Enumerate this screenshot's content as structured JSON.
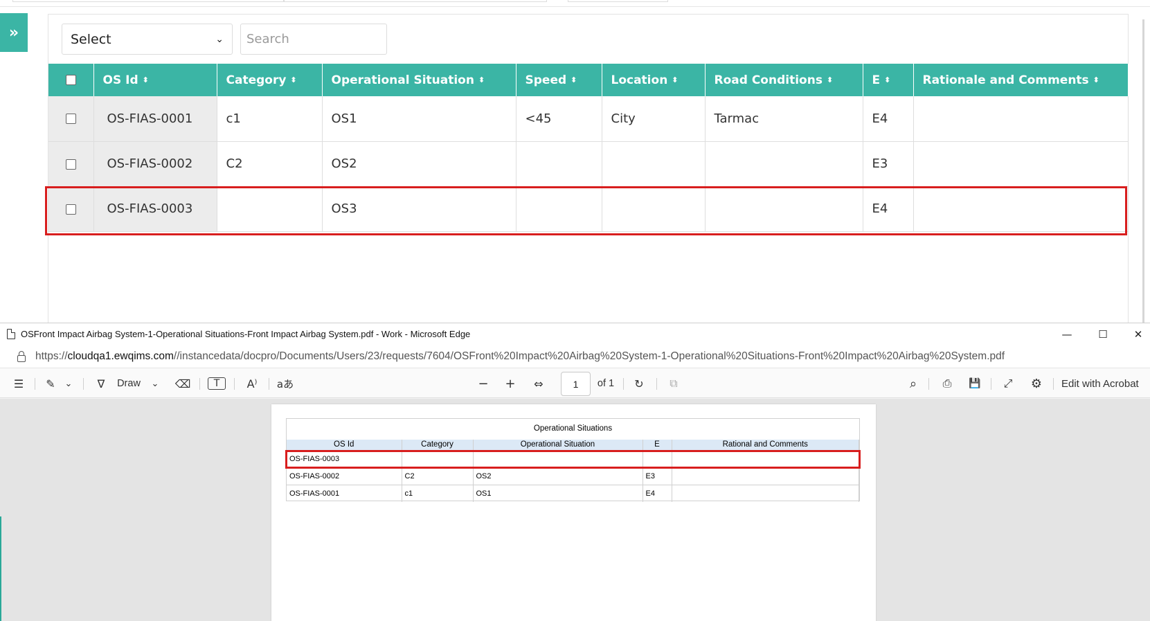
{
  "app": {
    "select": {
      "value": "Select"
    },
    "search": {
      "placeholder": "Search"
    },
    "toggle_glyph": "»",
    "table": {
      "headers": [
        "OS Id",
        "Category",
        "Operational Situation",
        "Speed",
        "Location",
        "Road Conditions",
        "E",
        "Rationale and Comments"
      ],
      "sort_glyph": "⬍",
      "rows": [
        [
          "OS-FIAS-0001",
          "c1",
          "OS1",
          "<45",
          "City",
          "Tarmac",
          "E4",
          ""
        ],
        [
          "OS-FIAS-0002",
          "C2",
          "OS2",
          "",
          "",
          "",
          "E3",
          ""
        ],
        [
          "OS-FIAS-0003",
          "",
          "OS3",
          "",
          "",
          "",
          "E4",
          ""
        ]
      ]
    }
  },
  "edge": {
    "title": "OSFront Impact Airbag System-1-Operational Situations-Front Impact Airbag System.pdf - Work - Microsoft Edge",
    "controls": {
      "minimize": "—",
      "maximize": "☐",
      "close": "✕"
    },
    "url": {
      "scheme": "https://",
      "host": "cloudqa1.ewqims.com",
      "path": "//instancedata/docpro/Documents/Users/23/requests/7604/OSFront%20Impact%20Airbag%20System-1-Operational%20Situations-Front%20Impact%20Airbag%20System.pdf"
    },
    "toolbar": {
      "contents_icon": "☰",
      "highlight_icon": "✎",
      "chevron": "⌄",
      "draw_icon": "∇",
      "draw_label": "Draw",
      "erase_icon": "⌫",
      "textbox_icon": "T",
      "read_aloud_icon": "A⁾",
      "translate_icon": "aあ",
      "zoom_out": "−",
      "zoom_in": "+",
      "fit_icon": "⇔",
      "page_number": "1",
      "page_total": "of 1",
      "rotate_icon": "↻",
      "two_page_icon": "⧉",
      "search_icon": "⌕",
      "print_icon": "⎙",
      "save_icon": "💾",
      "fullscreen_icon": "⤢",
      "settings_icon": "⚙",
      "acrobat_label": "Edit with Acrobat"
    },
    "pdf": {
      "title": "Operational Situations",
      "headers": [
        "OS Id",
        "Category",
        "Operational Situation",
        "E",
        "Rational and Comments"
      ],
      "rows": [
        [
          "OS-FIAS-0003",
          "",
          "",
          "",
          ""
        ],
        [
          "OS-FIAS-0002",
          "C2",
          "OS2",
          "E3",
          ""
        ],
        [
          "OS-FIAS-0001",
          "c1",
          "OS1",
          "E4",
          ""
        ]
      ]
    }
  },
  "colors": {
    "accent": "#3bb5a5",
    "highlight": "#d81e1e",
    "pdf_header": "#dce9f6"
  }
}
